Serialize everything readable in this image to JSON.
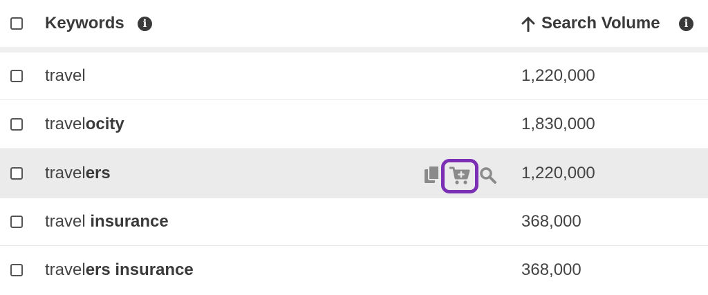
{
  "header": {
    "keywords_label": "Keywords",
    "search_volume_label": "Search Volume",
    "info_glyph": "i",
    "sort_direction": "ascending"
  },
  "rows": [
    {
      "prefix": "travel",
      "suffix": "",
      "volume": "1,220,000"
    },
    {
      "prefix": "travel",
      "suffix": "ocity",
      "volume": "1,830,000"
    },
    {
      "prefix": "travel",
      "suffix": "ers",
      "volume": "1,220,000",
      "hovered": true,
      "actions": [
        "copy-icon",
        "add-to-cart-icon",
        "search-icon"
      ]
    },
    {
      "prefix": "travel ",
      "suffix": "insurance",
      "volume": "368,000"
    },
    {
      "prefix": "travel",
      "suffix": "ers insurance",
      "volume": "368,000"
    }
  ],
  "colors": {
    "highlight_row": "#ebebeb",
    "focus_ring": "#7b2fb5",
    "action_icon": "#8a8a8a"
  }
}
